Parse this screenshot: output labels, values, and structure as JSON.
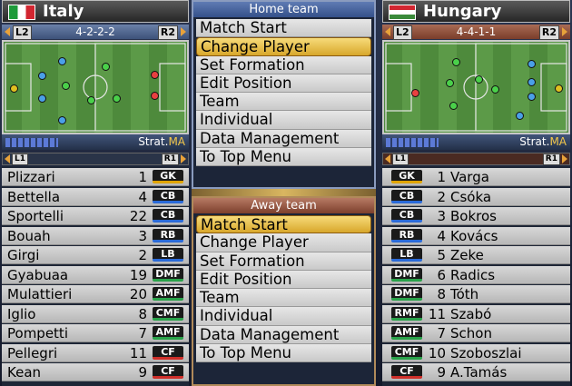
{
  "home": {
    "team_name": "Italy",
    "formation": "4-2-2-2",
    "left_tag": "L2",
    "right_tag": "R2",
    "strategy_label": "Strat.",
    "strategy_value": "MA",
    "list_left_tag": "L1",
    "list_right_tag": "R1",
    "flag_colors": [
      "#1e9a3a",
      "#ffffff",
      "#d22630"
    ],
    "players": [
      {
        "name": "Plizzari",
        "number": "1",
        "position": "GK",
        "pos_color": "#e0a400"
      },
      {
        "name": "Bettella",
        "number": "4",
        "position": "CB",
        "pos_color": "#2a6ad8"
      },
      {
        "name": "Sportelli",
        "number": "22",
        "position": "CB",
        "pos_color": "#2a6ad8"
      },
      {
        "name": "Bouah",
        "number": "3",
        "position": "RB",
        "pos_color": "#2a6ad8"
      },
      {
        "name": "Girgi",
        "number": "2",
        "position": "LB",
        "pos_color": "#2a6ad8"
      },
      {
        "name": "Gyabuaa",
        "number": "19",
        "position": "DMF",
        "pos_color": "#2aa24a"
      },
      {
        "name": "Mulattieri",
        "number": "20",
        "position": "AMF",
        "pos_color": "#2aa24a"
      },
      {
        "name": "Iglio",
        "number": "8",
        "position": "CMF",
        "pos_color": "#2aa24a"
      },
      {
        "name": "Pompetti",
        "number": "7",
        "position": "AMF",
        "pos_color": "#2aa24a"
      },
      {
        "name": "Pellegri",
        "number": "11",
        "position": "CF",
        "pos_color": "#d0302a"
      },
      {
        "name": "Kean",
        "number": "9",
        "position": "CF",
        "pos_color": "#d0302a"
      }
    ]
  },
  "away": {
    "team_name": "Hungary",
    "formation": "4-4-1-1",
    "left_tag": "L2",
    "right_tag": "R2",
    "strategy_label": "Strat.",
    "strategy_value": "MA",
    "list_left_tag": "L1",
    "list_right_tag": "R1",
    "flag_colors": [
      "#d22630",
      "#ffffff",
      "#3a8a3a"
    ],
    "players": [
      {
        "name": "Varga",
        "number": "1",
        "position": "GK",
        "pos_color": "#e0a400"
      },
      {
        "name": "Csóka",
        "number": "2",
        "position": "CB",
        "pos_color": "#2a6ad8"
      },
      {
        "name": "Bokros",
        "number": "3",
        "position": "CB",
        "pos_color": "#2a6ad8"
      },
      {
        "name": "Kovács",
        "number": "4",
        "position": "RB",
        "pos_color": "#2a6ad8"
      },
      {
        "name": "Zeke",
        "number": "5",
        "position": "LB",
        "pos_color": "#2a6ad8"
      },
      {
        "name": "Radics",
        "number": "6",
        "position": "DMF",
        "pos_color": "#2aa24a"
      },
      {
        "name": "Tóth",
        "number": "8",
        "position": "DMF",
        "pos_color": "#2aa24a"
      },
      {
        "name": "Szabó",
        "number": "11",
        "position": "RMF",
        "pos_color": "#2aa24a"
      },
      {
        "name": "Schon",
        "number": "7",
        "position": "AMF",
        "pos_color": "#2aa24a"
      },
      {
        "name": "Szoboszlai",
        "number": "10",
        "position": "CMF",
        "pos_color": "#2aa24a"
      },
      {
        "name": "A.Tamás",
        "number": "9",
        "position": "CF",
        "pos_color": "#d0302a"
      }
    ]
  },
  "home_menu": {
    "title": "Home team",
    "items": [
      "Match Start",
      "Change Player",
      "Set Formation",
      "Edit Position",
      "Team",
      "Individual",
      "Data Management",
      "To Top Menu"
    ],
    "selected": "Change Player"
  },
  "away_menu": {
    "title": "Away team",
    "items": [
      "Match Start",
      "Change Player",
      "Set Formation",
      "Edit Position",
      "Team",
      "Individual",
      "Data Management",
      "To Top Menu"
    ],
    "selected": "Match Start"
  }
}
